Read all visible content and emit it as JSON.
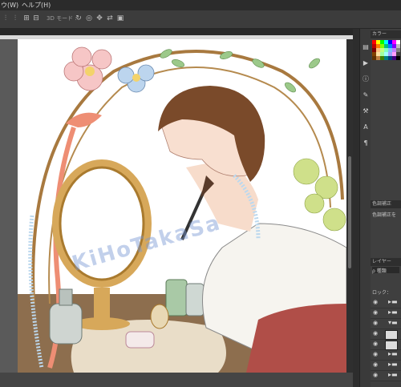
{
  "menu": {
    "items": [
      "ウ(W)",
      "ヘルプ(H)"
    ]
  },
  "options_bar": {
    "mode_label": "3D モード :"
  },
  "panels": {
    "swatches_tab": "カラー",
    "adjustments_tab": "色調補正",
    "adjustments_label": "色調補正を",
    "layers_tab": "レイヤー",
    "layers_kind": "ρ 種類",
    "layers_lock": "ロック："
  },
  "artwork": {
    "watermark": "KiHoTakaSa"
  },
  "colors": {
    "menubar": "#2b2b2b",
    "workspace": "#535353",
    "panel": "#3f3f3f",
    "canvas": "#ffffff"
  },
  "swatch_colors": [
    "#ff0000",
    "#ffff00",
    "#00ff00",
    "#00ffff",
    "#0000ff",
    "#ff00ff",
    "#ffffff",
    "#c00000",
    "#ff8000",
    "#80ff00",
    "#00c080",
    "#0080ff",
    "#8000ff",
    "#c0c0c0",
    "#800000",
    "#ffc080",
    "#c0ff80",
    "#80ffc0",
    "#80c0ff",
    "#c080ff",
    "#808080",
    "#804000",
    "#ffe0a0",
    "#a0ffa0",
    "#a0ffff",
    "#a0a0ff",
    "#ffa0ff",
    "#404040",
    "#603000",
    "#c08040",
    "#408000",
    "#008080",
    "#004080",
    "#400080",
    "#000000"
  ]
}
